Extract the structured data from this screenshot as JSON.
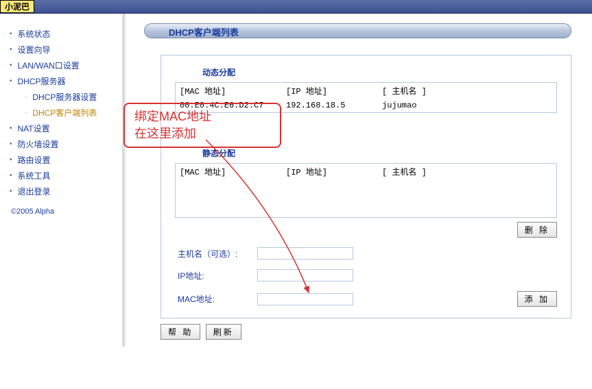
{
  "titlebar": {
    "badge": "小泥巴"
  },
  "sidebar": {
    "items": [
      {
        "label": "系统状态"
      },
      {
        "label": "设置向导"
      },
      {
        "label": "LAN/WAN口设置"
      },
      {
        "label": "DHCP服务器"
      },
      {
        "label": "NAT设置"
      },
      {
        "label": "防火墙设置"
      },
      {
        "label": "路由设置"
      },
      {
        "label": "系统工具"
      },
      {
        "label": "退出登录"
      }
    ],
    "subitems": [
      {
        "label": "DHCP服务器设置"
      },
      {
        "label": "DHCP客户端列表"
      }
    ],
    "copyright": "©2005 Alpha"
  },
  "page": {
    "title": "DHCP客户端列表"
  },
  "dynamic": {
    "title": "动态分配",
    "head": {
      "mac": "[MAC 地址]",
      "ip": "[IP 地址]",
      "host": "[ 主机名 ]"
    },
    "rows": [
      {
        "mac": "00:E0:4C:E6:D2:C7",
        "ip": "192.168.18.5",
        "host": "jujumao"
      }
    ]
  },
  "static": {
    "title": "静态分配",
    "head": {
      "mac": "[MAC 地址]",
      "ip": "[IP 地址]",
      "host": "[ 主机名 ]"
    }
  },
  "buttons": {
    "delete": "删 除",
    "add": "添 加",
    "help": "帮 助",
    "refresh": "刷新"
  },
  "form": {
    "hostname_label": "主机名（可选）:",
    "ip_label": "IP地址:",
    "mac_label": "MAC地址:"
  },
  "annotation": {
    "line1": "绑定MAC地址",
    "line2": "在这里添加"
  }
}
